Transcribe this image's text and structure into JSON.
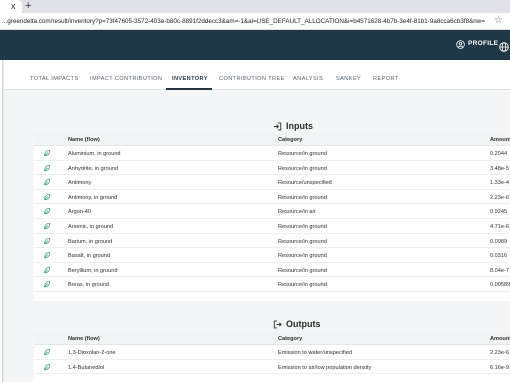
{
  "browser": {
    "url": "...greendelta.com/result/inventory?p=73f47605-3572-403e-b80c-8891f2ddecc3&am=-1&al=USE_DEFAULT_ALLOCATION&i=b4571628-4b7b-3e4f-81b1-9a8cca6cb3f8&nw=",
    "new_tab_glyph": "+",
    "close_glyph": "x",
    "star_glyph": "☆"
  },
  "header": {
    "profile_label": "PROFILE"
  },
  "tabs": [
    {
      "label": "TOTAL IMPACTS",
      "active": false
    },
    {
      "label": "IMPACT CONTRIBUTION",
      "active": false
    },
    {
      "label": "INVENTORY",
      "active": true
    },
    {
      "label": "CONTRIBUTION TREE",
      "active": false
    },
    {
      "label": "ANALYSIS",
      "active": false
    },
    {
      "label": "SANKEY",
      "active": false
    },
    {
      "label": "REPORT",
      "active": false
    }
  ],
  "inputs": {
    "title": "Inputs",
    "columns": {
      "name": "Name (flow)",
      "category": "Category",
      "amount": "Amount"
    },
    "rows": [
      {
        "name": "Aluminium, in ground",
        "category": "Resource/in ground",
        "amount": "0.2044"
      },
      {
        "name": "Anhydrite, in ground",
        "category": "Resource/in ground",
        "amount": "3.48e-5"
      },
      {
        "name": "Antimony",
        "category": "Resource/unspecified",
        "amount": "1.33e-4"
      },
      {
        "name": "Antimony, in ground",
        "category": "Resource/in ground",
        "amount": "2.23e-6"
      },
      {
        "name": "Argon-40",
        "category": "Resource/in air",
        "amount": "0.9245"
      },
      {
        "name": "Arsenic, in ground",
        "category": "Resource/in ground",
        "amount": "4.71e-6"
      },
      {
        "name": "Barium, in ground",
        "category": "Resource/in ground",
        "amount": "0.0989"
      },
      {
        "name": "Basalt, in ground",
        "category": "Resource/in ground",
        "amount": "0.0316"
      },
      {
        "name": "Beryllium, in ground",
        "category": "Resource/in ground",
        "amount": "8.04e-7"
      },
      {
        "name": "Borax, in ground",
        "category": "Resource/in ground",
        "amount": "0.00589"
      }
    ]
  },
  "outputs": {
    "title": "Outputs",
    "columns": {
      "name": "Name (flow)",
      "category": "Category",
      "amount": "Amount"
    },
    "rows": [
      {
        "name": "1,3-Dioxolan-2-one",
        "category": "Emission to water/unspecified",
        "amount": "2.23e-6"
      },
      {
        "name": "1,4-Butanediol",
        "category": "Emission to air/low population density",
        "amount": "6.16e-9"
      }
    ]
  },
  "colors": {
    "header_bg": "#1f3847",
    "leaf_icon": "#2e9e6b"
  }
}
